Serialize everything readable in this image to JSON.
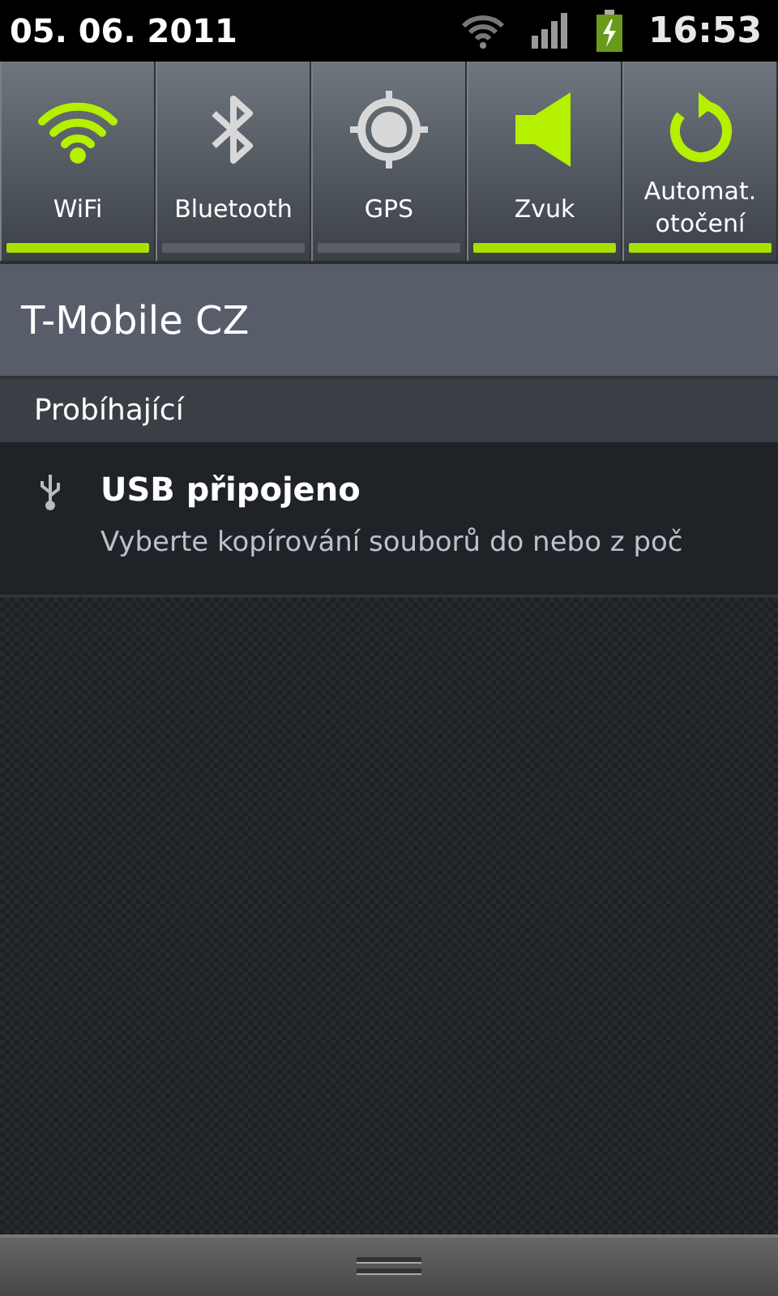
{
  "status_bar": {
    "date": "05. 06. 2011",
    "time": "16:53"
  },
  "toggles": [
    {
      "kind": "wifi",
      "label": "WiFi",
      "on": true
    },
    {
      "kind": "bluetooth",
      "label": "Bluetooth",
      "on": false
    },
    {
      "kind": "gps",
      "label": "GPS",
      "on": false
    },
    {
      "kind": "sound",
      "label": "Zvuk",
      "on": true
    },
    {
      "kind": "rotate",
      "label": "Automat.\notočení",
      "on": true
    }
  ],
  "carrier": "T-Mobile CZ",
  "section": "Probíhající",
  "notifications": [
    {
      "title": "USB připojeno",
      "text": "Vyberte kopírování souborů do nebo z poč"
    }
  ]
}
